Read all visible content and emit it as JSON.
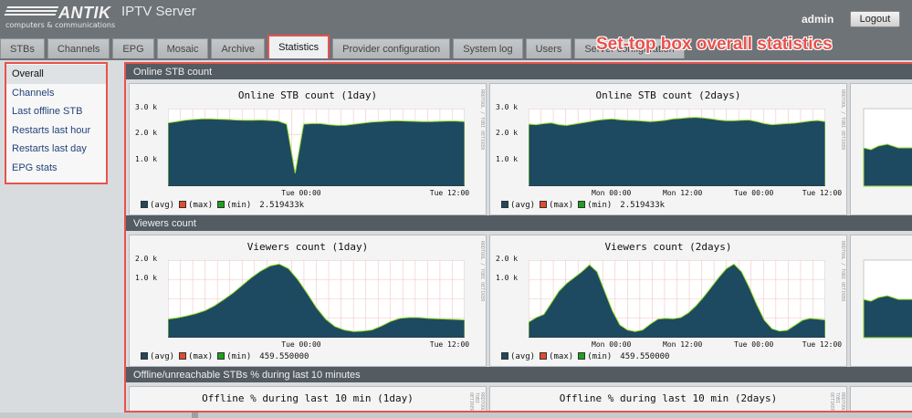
{
  "header": {
    "logo_text": "ANTIK",
    "logo_tagline": "computers & communications",
    "app_title": "IPTV Server",
    "user": "admin",
    "logout_label": "Logout",
    "overlay_caption": "Set-top box overall statistics"
  },
  "tabs": [
    "STBs",
    "Channels",
    "EPG",
    "Mosaic",
    "Archive",
    "Statistics",
    "Provider configuration",
    "System log",
    "Users",
    "Server configuration"
  ],
  "active_tab": "Statistics",
  "sidebar": {
    "items": [
      "Overall",
      "Channels",
      "Last offline STB",
      "Restarts last hour",
      "Restarts last day",
      "EPG stats"
    ],
    "active": "Overall"
  },
  "colors": {
    "avg": "#1d4a60",
    "max": "#e24b2c",
    "min": "#1ea01e",
    "accent": "#e8524d",
    "min_line": "#9ae030"
  },
  "sections": [
    {
      "title": "Online STB count"
    },
    {
      "title": "Viewers count"
    },
    {
      "title": "Offline/unreachable STBs % during last 10 minutes"
    }
  ],
  "graph_watermark": "RRDTOOL / TOBI OETIKER",
  "legend": {
    "avg": "(avg)",
    "max": "(max)",
    "min": "(min)"
  },
  "chart_data": [
    {
      "type": "area",
      "title": "Online STB count (1day)",
      "ylim": [
        0,
        3000
      ],
      "yticks": [
        "3.0 k",
        "2.0 k",
        "1.0 k"
      ],
      "xticks": [
        "Tue 00:00",
        "Tue 12:00"
      ],
      "legend_value": "2.519433k",
      "series": [
        {
          "name": "avg",
          "values": [
            2450,
            2500,
            2550,
            2580,
            2600,
            2600,
            2590,
            2580,
            2560,
            2550,
            2550,
            2560,
            2540,
            2520,
            2400,
            500,
            2400,
            2420,
            2420,
            2380,
            2350,
            2360,
            2400,
            2440,
            2480,
            2500,
            2520,
            2530,
            2520,
            2510,
            2500,
            2500,
            2510,
            2520,
            2520,
            2500
          ]
        }
      ]
    },
    {
      "type": "area",
      "title": "Online STB count (2days)",
      "ylim": [
        0,
        3000
      ],
      "yticks": [
        "3.0 k",
        "2.0 k",
        "1.0 k"
      ],
      "xticks": [
        "Mon 00:00",
        "Mon 12:00",
        "Tue 00:00",
        "Tue 12:00"
      ],
      "legend_value": "2.519433k",
      "series": [
        {
          "name": "avg",
          "values": [
            2400,
            2380,
            2420,
            2450,
            2380,
            2350,
            2400,
            2450,
            2500,
            2550,
            2580,
            2600,
            2570,
            2550,
            2540,
            2520,
            2500,
            2520,
            2550,
            2600,
            2620,
            2650,
            2660,
            2640,
            2600,
            2560,
            2530,
            2530,
            2550,
            2560,
            2500,
            2420,
            2380,
            2400,
            2420,
            2440,
            2480,
            2520,
            2540,
            2500
          ]
        }
      ]
    },
    {
      "type": "area",
      "title": "Viewers count (1day)",
      "ylim": [
        0,
        2000
      ],
      "yticks": [
        "2.0 k",
        "1.0 k"
      ],
      "xticks": [
        "Tue 00:00",
        "Tue 12:00"
      ],
      "legend_value": "459.550000",
      "series": [
        {
          "name": "avg",
          "values": [
            480,
            510,
            560,
            620,
            700,
            820,
            980,
            1150,
            1350,
            1550,
            1720,
            1850,
            1900,
            1780,
            1500,
            1150,
            780,
            480,
            290,
            200,
            160,
            170,
            200,
            300,
            420,
            500,
            520,
            520,
            500,
            490,
            480,
            470,
            460
          ]
        }
      ]
    },
    {
      "type": "area",
      "title": "Viewers count (2days)",
      "ylim": [
        0,
        2000
      ],
      "yticks": [
        "2.0 k",
        "1.0 k"
      ],
      "xticks": [
        "Mon 00:00",
        "Mon 12:00",
        "Tue 00:00",
        "Tue 12:00"
      ],
      "legend_value": "459.550000",
      "series": [
        {
          "name": "avg",
          "values": [
            400,
            520,
            600,
            900,
            1200,
            1400,
            1550,
            1700,
            1880,
            1700,
            1200,
            700,
            330,
            200,
            160,
            200,
            350,
            480,
            500,
            490,
            520,
            640,
            820,
            1050,
            1300,
            1550,
            1780,
            1900,
            1700,
            1300,
            850,
            450,
            230,
            170,
            190,
            320,
            450,
            500,
            480,
            460
          ]
        }
      ]
    },
    {
      "type": "area",
      "title": "Offline % during last 10 min (1day)"
    },
    {
      "type": "area",
      "title": "Offline % during last 10 min (2days)"
    }
  ]
}
